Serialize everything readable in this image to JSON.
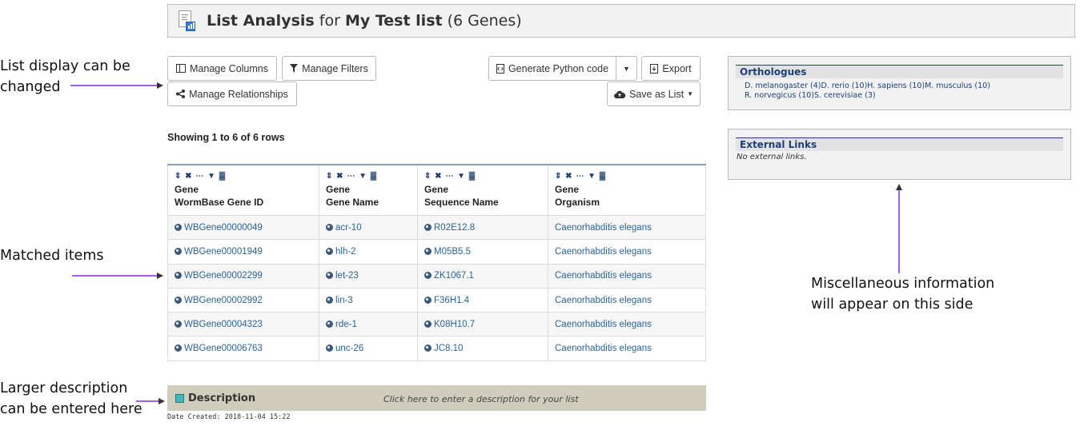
{
  "header": {
    "title_bold": "List Analysis",
    "title_for": "for",
    "list_name": "My Test list",
    "gene_count": "(6 Genes)",
    "icon": "list-analysis-icon"
  },
  "toolbar": {
    "manage_columns": "Manage Columns",
    "manage_filters": "Manage Filters",
    "manage_relationships": "Manage Relationships",
    "generate_python": "Generate Python code",
    "export": "Export",
    "save_as_list": "Save as List"
  },
  "table": {
    "showing": "Showing 1 to 6 of 6 rows",
    "columns": [
      {
        "class": "Gene",
        "field": "WormBase Gene ID"
      },
      {
        "class": "Gene",
        "field": "Gene Name"
      },
      {
        "class": "Gene",
        "field": "Sequence Name"
      },
      {
        "class": "Gene",
        "field": "Organism"
      }
    ],
    "column_controls": "⇕ ✖ ⋯ ▼ ▓",
    "rows": [
      [
        "WBGene00000049",
        "acr-10",
        "R02E12.8",
        "Caenorhabditis elegans"
      ],
      [
        "WBGene00001949",
        "hlh-2",
        "M05B5.5",
        "Caenorhabditis elegans"
      ],
      [
        "WBGene00002299",
        "let-23",
        "ZK1067.1",
        "Caenorhabditis elegans"
      ],
      [
        "WBGene00002992",
        "lin-3",
        "F36H1.4",
        "Caenorhabditis elegans"
      ],
      [
        "WBGene00004323",
        "rde-1",
        "K08H10.7",
        "Caenorhabditis elegans"
      ],
      [
        "WBGene00006763",
        "unc-26",
        "JC8.10",
        "Caenorhabditis elegans"
      ]
    ]
  },
  "description": {
    "label": "Description",
    "prompt": "Click here to enter a description for your list",
    "date_created": "Date Created: 2018-11-04 15:22"
  },
  "orthologues": {
    "title": "Orthologues",
    "line1": "D. melanogaster (4)D. rerio (10)H. sapiens (10)M. musculus (10)",
    "line2": "R. norvegicus (10)S. cerevisiae (3)"
  },
  "external_links": {
    "title": "External Links",
    "empty": "No external links."
  },
  "annotations": {
    "list_display_1": "List display can be",
    "list_display_2": "changed",
    "matched_items": "Matched items",
    "description_1": "Larger description",
    "description_2": "can be entered here",
    "misc_1": "Miscellaneous information",
    "misc_2": "will appear on this side"
  },
  "colors": {
    "link": "#2a6496",
    "panel_title": "#1e3f7a",
    "arrow": "#7b2fd6",
    "description_bar": "#d0cdbd"
  }
}
